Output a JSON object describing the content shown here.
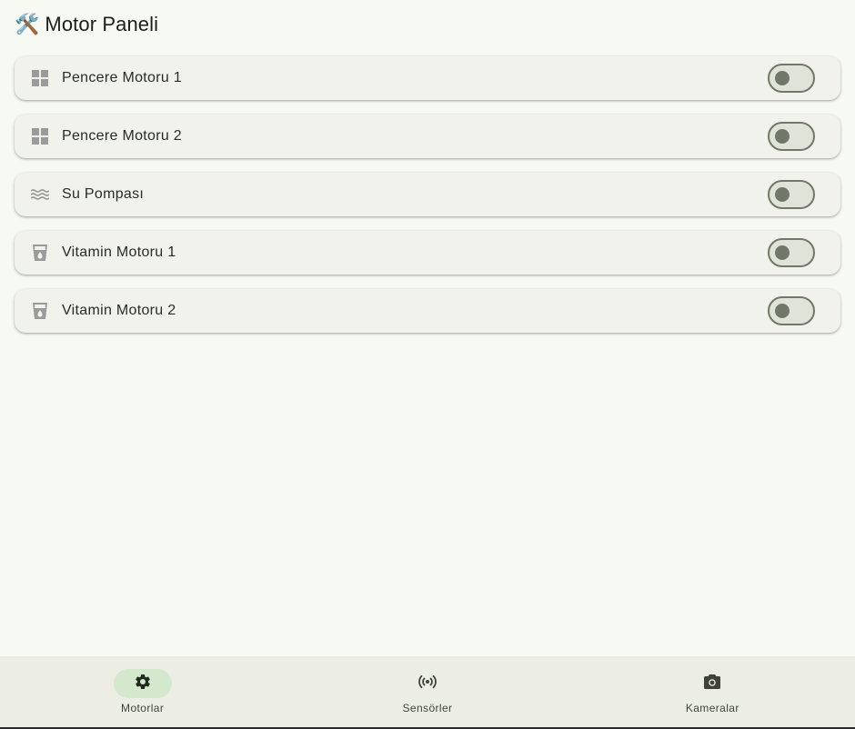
{
  "header": {
    "emoji": "🛠️",
    "title": "Motor Paneli"
  },
  "motors": [
    {
      "label": "Pencere Motoru 1",
      "icon": "window-icon",
      "on": false
    },
    {
      "label": "Pencere Motoru 2",
      "icon": "window-icon",
      "on": false
    },
    {
      "label": "Su Pompası",
      "icon": "water-waves-icon",
      "on": false
    },
    {
      "label": "Vitamin Motoru 1",
      "icon": "water-drop-cup-icon",
      "on": false
    },
    {
      "label": "Vitamin Motoru 2",
      "icon": "water-drop-cup-icon",
      "on": false
    }
  ],
  "nav": {
    "items": [
      {
        "label": "Motorlar",
        "icon": "gear-icon",
        "active": true
      },
      {
        "label": "Sensörler",
        "icon": "sensor-broadcast-icon",
        "active": false
      },
      {
        "label": "Kameralar",
        "icon": "camera-icon",
        "active": false
      }
    ]
  },
  "colors": {
    "background": "#f7faf2",
    "card": "#f0f2eb",
    "switch_off_track": "#e0e3d9",
    "switch_off_outline": "#707868",
    "nav_bg": "#eceee6",
    "nav_active_pill": "#d3e8cc",
    "icon_gray": "#9a9a9a"
  }
}
